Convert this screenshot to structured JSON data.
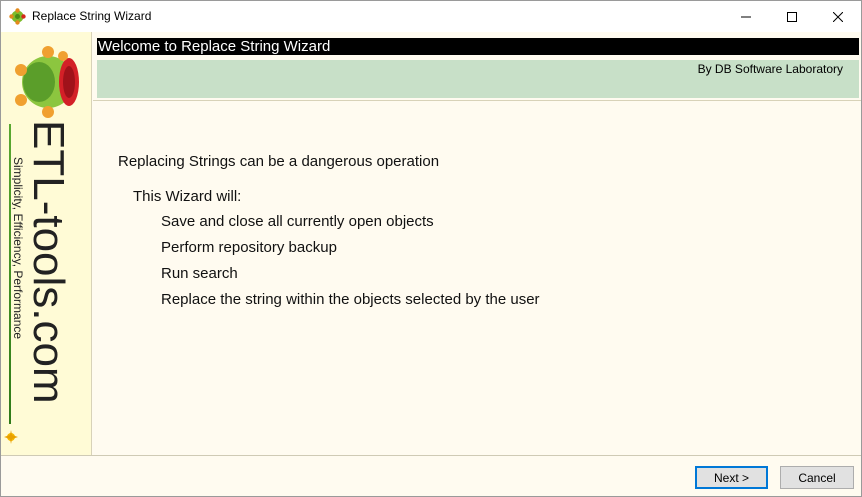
{
  "window": {
    "title": "Replace String Wizard"
  },
  "banner": {
    "brand": "ETL-tools.com",
    "tagline": "Simplicity, Efficiency, Performance"
  },
  "header": {
    "title": "Welcome to Replace String Wizard",
    "subtitle": "By DB Software Laboratory"
  },
  "content": {
    "warning": "Replacing Strings can be a dangerous operation",
    "intro": "This Wizard will:",
    "steps": [
      "Save and close all currently open objects",
      "Perform repository backup",
      "Run search",
      "Replace the string within the objects selected by the user"
    ]
  },
  "buttons": {
    "next": "Next >",
    "cancel": "Cancel"
  },
  "colors": {
    "header_black": "#000000",
    "header_green": "#c8e0c8",
    "banner_bg": "#fffbd6",
    "content_bg": "#fffbf0",
    "focus_border": "#0078d7"
  }
}
